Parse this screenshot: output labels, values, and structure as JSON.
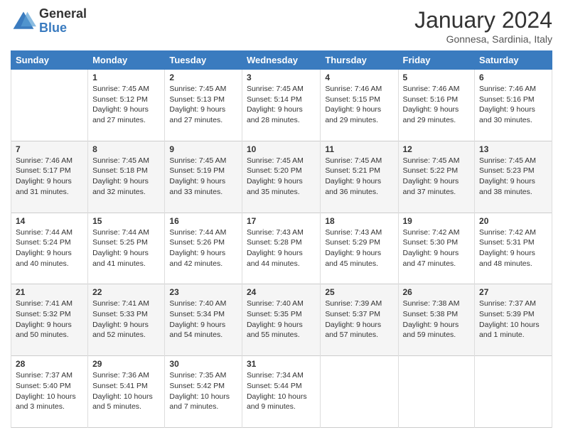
{
  "logo": {
    "general": "General",
    "blue": "Blue"
  },
  "title": "January 2024",
  "subtitle": "Gonnesa, Sardinia, Italy",
  "days_of_week": [
    "Sunday",
    "Monday",
    "Tuesday",
    "Wednesday",
    "Thursday",
    "Friday",
    "Saturday"
  ],
  "weeks": [
    [
      {
        "day": "",
        "info": ""
      },
      {
        "day": "1",
        "info": "Sunrise: 7:45 AM\nSunset: 5:12 PM\nDaylight: 9 hours\nand 27 minutes."
      },
      {
        "day": "2",
        "info": "Sunrise: 7:45 AM\nSunset: 5:13 PM\nDaylight: 9 hours\nand 27 minutes."
      },
      {
        "day": "3",
        "info": "Sunrise: 7:45 AM\nSunset: 5:14 PM\nDaylight: 9 hours\nand 28 minutes."
      },
      {
        "day": "4",
        "info": "Sunrise: 7:46 AM\nSunset: 5:15 PM\nDaylight: 9 hours\nand 29 minutes."
      },
      {
        "day": "5",
        "info": "Sunrise: 7:46 AM\nSunset: 5:16 PM\nDaylight: 9 hours\nand 29 minutes."
      },
      {
        "day": "6",
        "info": "Sunrise: 7:46 AM\nSunset: 5:16 PM\nDaylight: 9 hours\nand 30 minutes."
      }
    ],
    [
      {
        "day": "7",
        "info": "Sunrise: 7:46 AM\nSunset: 5:17 PM\nDaylight: 9 hours\nand 31 minutes."
      },
      {
        "day": "8",
        "info": "Sunrise: 7:45 AM\nSunset: 5:18 PM\nDaylight: 9 hours\nand 32 minutes."
      },
      {
        "day": "9",
        "info": "Sunrise: 7:45 AM\nSunset: 5:19 PM\nDaylight: 9 hours\nand 33 minutes."
      },
      {
        "day": "10",
        "info": "Sunrise: 7:45 AM\nSunset: 5:20 PM\nDaylight: 9 hours\nand 35 minutes."
      },
      {
        "day": "11",
        "info": "Sunrise: 7:45 AM\nSunset: 5:21 PM\nDaylight: 9 hours\nand 36 minutes."
      },
      {
        "day": "12",
        "info": "Sunrise: 7:45 AM\nSunset: 5:22 PM\nDaylight: 9 hours\nand 37 minutes."
      },
      {
        "day": "13",
        "info": "Sunrise: 7:45 AM\nSunset: 5:23 PM\nDaylight: 9 hours\nand 38 minutes."
      }
    ],
    [
      {
        "day": "14",
        "info": "Sunrise: 7:44 AM\nSunset: 5:24 PM\nDaylight: 9 hours\nand 40 minutes."
      },
      {
        "day": "15",
        "info": "Sunrise: 7:44 AM\nSunset: 5:25 PM\nDaylight: 9 hours\nand 41 minutes."
      },
      {
        "day": "16",
        "info": "Sunrise: 7:44 AM\nSunset: 5:26 PM\nDaylight: 9 hours\nand 42 minutes."
      },
      {
        "day": "17",
        "info": "Sunrise: 7:43 AM\nSunset: 5:28 PM\nDaylight: 9 hours\nand 44 minutes."
      },
      {
        "day": "18",
        "info": "Sunrise: 7:43 AM\nSunset: 5:29 PM\nDaylight: 9 hours\nand 45 minutes."
      },
      {
        "day": "19",
        "info": "Sunrise: 7:42 AM\nSunset: 5:30 PM\nDaylight: 9 hours\nand 47 minutes."
      },
      {
        "day": "20",
        "info": "Sunrise: 7:42 AM\nSunset: 5:31 PM\nDaylight: 9 hours\nand 48 minutes."
      }
    ],
    [
      {
        "day": "21",
        "info": "Sunrise: 7:41 AM\nSunset: 5:32 PM\nDaylight: 9 hours\nand 50 minutes."
      },
      {
        "day": "22",
        "info": "Sunrise: 7:41 AM\nSunset: 5:33 PM\nDaylight: 9 hours\nand 52 minutes."
      },
      {
        "day": "23",
        "info": "Sunrise: 7:40 AM\nSunset: 5:34 PM\nDaylight: 9 hours\nand 54 minutes."
      },
      {
        "day": "24",
        "info": "Sunrise: 7:40 AM\nSunset: 5:35 PM\nDaylight: 9 hours\nand 55 minutes."
      },
      {
        "day": "25",
        "info": "Sunrise: 7:39 AM\nSunset: 5:37 PM\nDaylight: 9 hours\nand 57 minutes."
      },
      {
        "day": "26",
        "info": "Sunrise: 7:38 AM\nSunset: 5:38 PM\nDaylight: 9 hours\nand 59 minutes."
      },
      {
        "day": "27",
        "info": "Sunrise: 7:37 AM\nSunset: 5:39 PM\nDaylight: 10 hours\nand 1 minute."
      }
    ],
    [
      {
        "day": "28",
        "info": "Sunrise: 7:37 AM\nSunset: 5:40 PM\nDaylight: 10 hours\nand 3 minutes."
      },
      {
        "day": "29",
        "info": "Sunrise: 7:36 AM\nSunset: 5:41 PM\nDaylight: 10 hours\nand 5 minutes."
      },
      {
        "day": "30",
        "info": "Sunrise: 7:35 AM\nSunset: 5:42 PM\nDaylight: 10 hours\nand 7 minutes."
      },
      {
        "day": "31",
        "info": "Sunrise: 7:34 AM\nSunset: 5:44 PM\nDaylight: 10 hours\nand 9 minutes."
      },
      {
        "day": "",
        "info": ""
      },
      {
        "day": "",
        "info": ""
      },
      {
        "day": "",
        "info": ""
      }
    ]
  ]
}
